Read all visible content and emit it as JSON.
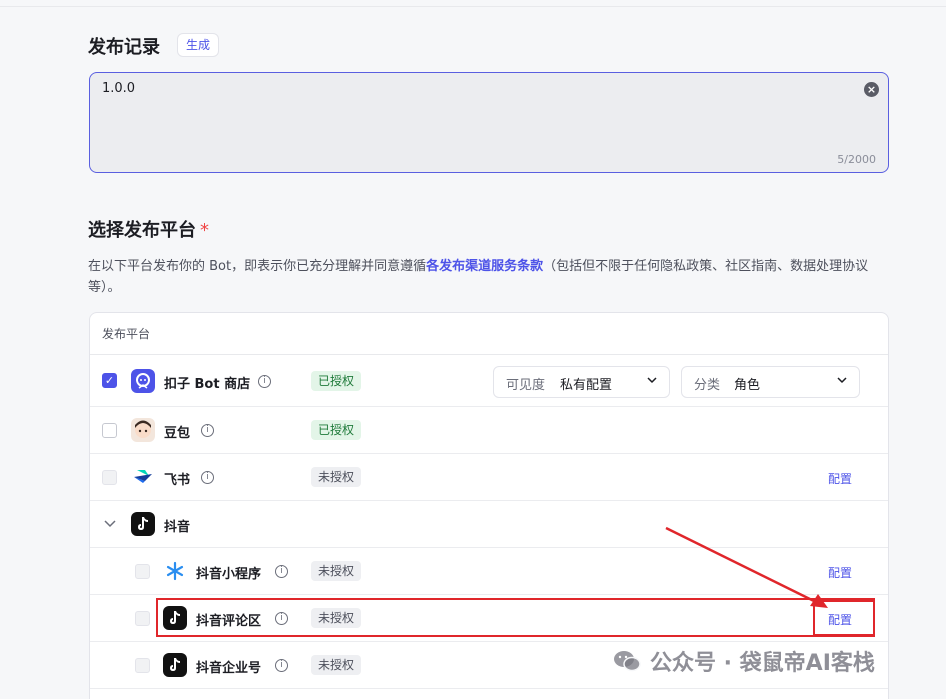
{
  "release": {
    "title": "发布记录",
    "generate_label": "生成",
    "textarea_value": "1.0.0",
    "char_count": "5/2000"
  },
  "platform_section": {
    "title": "选择发布平台",
    "required_mark": "*",
    "desc_before": "在以下平台发布你的 Bot，即表示你已充分理解并同意遵循",
    "desc_link": "各发布渠道服务条款",
    "desc_after": "（包括但不限于任何隐私政策、社区指南、数据处理协议等）。"
  },
  "table": {
    "header": "发布平台",
    "rows": [
      {
        "name": "扣子 Bot 商店",
        "status": "已授权",
        "checked": true
      },
      {
        "name": "豆包",
        "status": "已授权",
        "checked": false
      },
      {
        "name": "飞书",
        "status": "未授权",
        "config": "配置",
        "disabled": true
      },
      {
        "name": "抖音",
        "group": true
      },
      {
        "name": "抖音小程序",
        "status": "未授权",
        "config": "配置",
        "disabled": true
      },
      {
        "name": "抖音评论区",
        "status": "未授权",
        "config": "配置",
        "disabled": true
      },
      {
        "name": "抖音企业号",
        "status": "未授权",
        "config": "配置",
        "disabled": true
      }
    ],
    "visibility": {
      "label": "可见度",
      "value": "私有配置"
    },
    "category": {
      "label": "分类",
      "value": "角色"
    }
  },
  "watermark": "公众号 · 袋鼠帝AI客栈",
  "colors": {
    "accent": "#4d53e8",
    "annotation": "#e0262b"
  }
}
